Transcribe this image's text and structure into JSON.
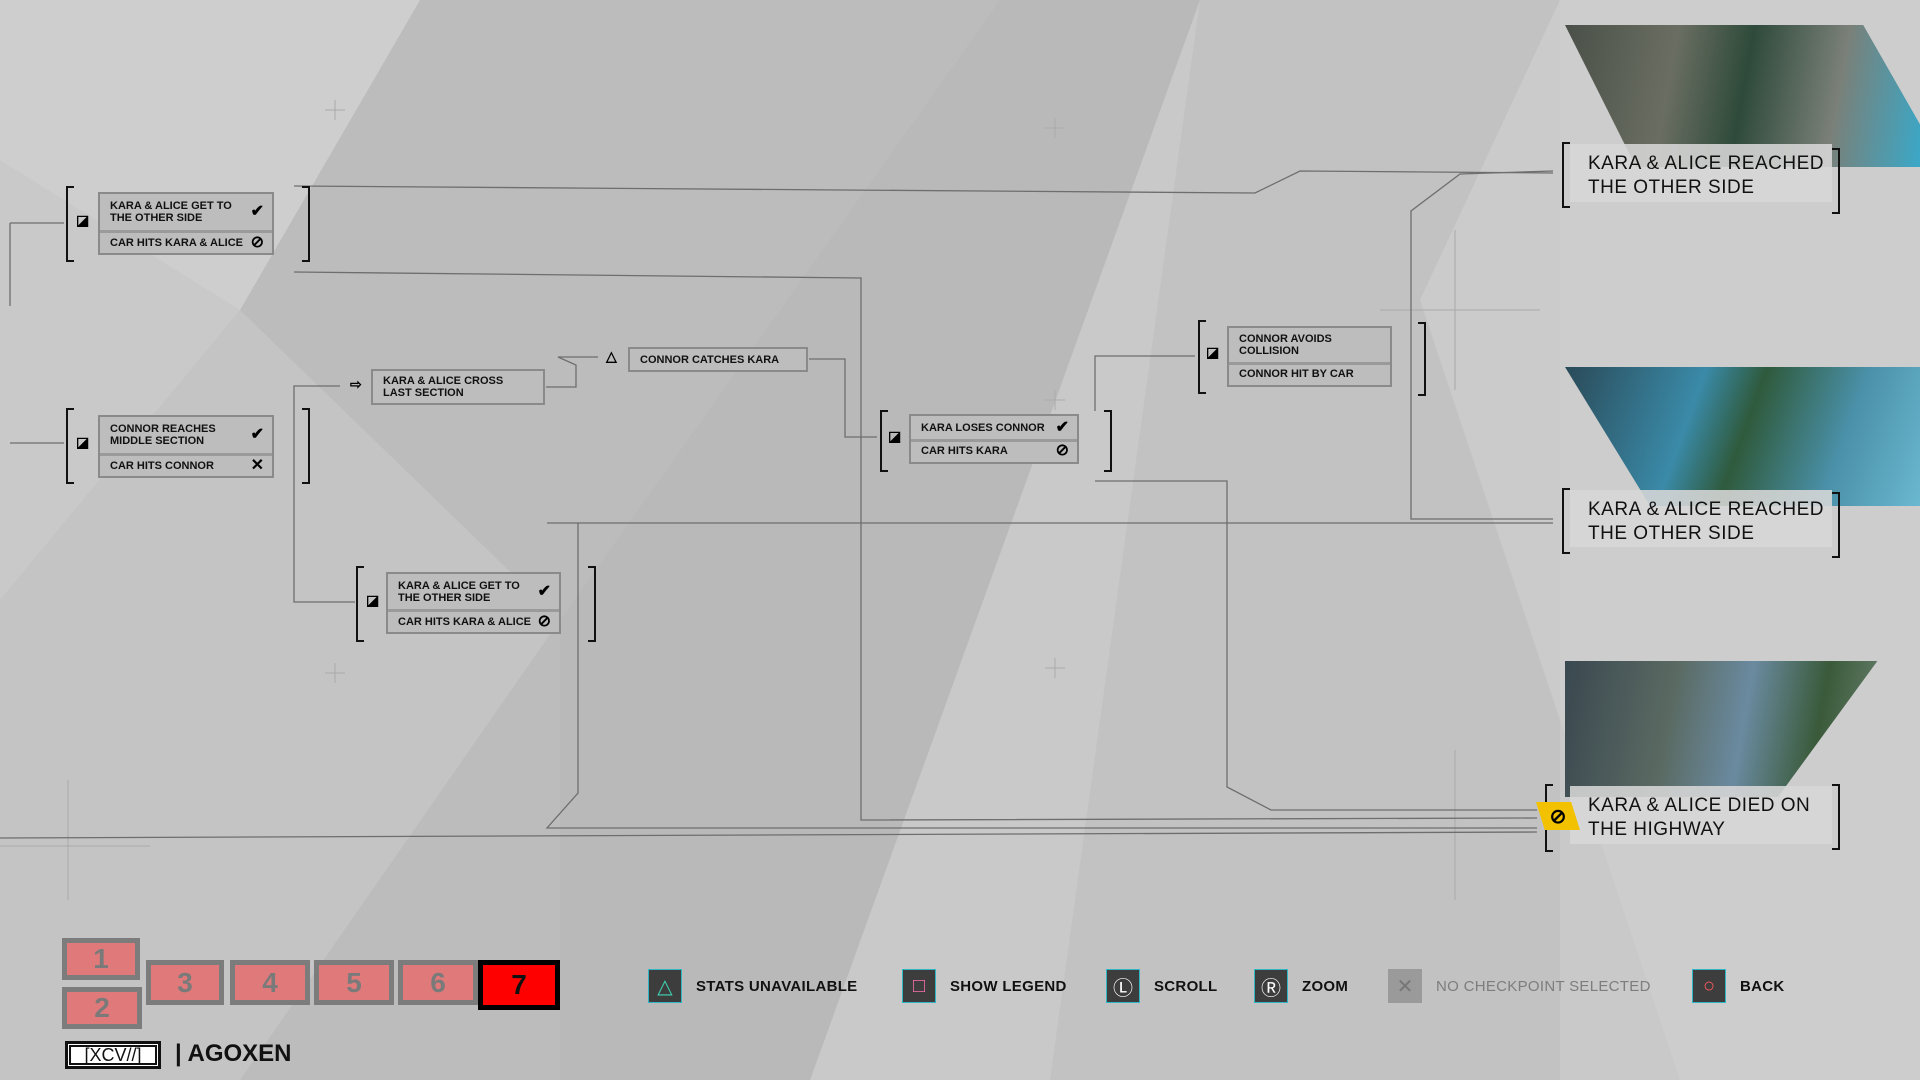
{
  "nodes": {
    "choice_top": {
      "options": [
        {
          "label": "KARA & ALICE GET TO THE OTHER SIDE",
          "status": "check"
        },
        {
          "label": "CAR HITS KARA & ALICE",
          "status": "blocked"
        }
      ]
    },
    "choice_mid": {
      "options": [
        {
          "label": "CONNOR REACHES MIDDLE SECTION",
          "status": "check"
        },
        {
          "label": "CAR HITS CONNOR",
          "status": "failed"
        }
      ]
    },
    "cross_section": {
      "label": "KARA & ALICE CROSS LAST SECTION"
    },
    "connor_catches": {
      "label": "CONNOR CATCHES KARA"
    },
    "choice_low": {
      "options": [
        {
          "label": "KARA & ALICE GET TO THE OTHER SIDE",
          "status": "check"
        },
        {
          "label": "CAR HITS KARA & ALICE",
          "status": "blocked"
        }
      ]
    },
    "loses_connor": {
      "options": [
        {
          "label": "KARA LOSES CONNOR",
          "status": "check"
        },
        {
          "label": "CAR HITS KARA",
          "status": "blocked"
        }
      ]
    },
    "connor_avoids": {
      "options": [
        {
          "label": "CONNOR AVOIDS COLLISION",
          "status": ""
        },
        {
          "label": "CONNOR HIT BY CAR",
          "status": ""
        }
      ]
    }
  },
  "status_glyphs": {
    "check": "✔",
    "blocked": "⃠",
    "failed": "✕"
  },
  "endings": [
    {
      "title": "KARA & ALICE REACHED THE OTHER SIDE",
      "badge": ""
    },
    {
      "title": "KARA & ALICE REACHED THE OTHER SIDE",
      "badge": ""
    },
    {
      "title": "KARA & ALICE DIED ON THE HIGHWAY",
      "badge": "prohibited-icon"
    }
  ],
  "chapters": {
    "items": [
      "1",
      "2",
      "3",
      "4",
      "5",
      "6",
      "7"
    ],
    "active": "7"
  },
  "brand": {
    "tag": "[XCV//]",
    "name": "| AGOXEN"
  },
  "watermark": "AGOXEN",
  "controls": [
    {
      "icon": "triangle-icon",
      "glyph": "△",
      "color": "#3fd6b4",
      "label": "STATS UNAVAILABLE"
    },
    {
      "icon": "square-icon",
      "glyph": "□",
      "color": "#ff6fb0",
      "label": "SHOW LEGEND"
    },
    {
      "icon": "left-stick-icon",
      "glyph": "Ⓛ",
      "color": "#ffffff",
      "label": "SCROLL"
    },
    {
      "icon": "right-stick-icon",
      "glyph": "Ⓡ",
      "color": "#ffffff",
      "label": "ZOOM"
    },
    {
      "icon": "cross-icon",
      "glyph": "✕",
      "color": "#8a8a8a",
      "label": "NO CHECKPOINT SELECTED"
    },
    {
      "icon": "circle-icon",
      "glyph": "○",
      "color": "#ff5a5a",
      "label": "BACK"
    }
  ],
  "colors": {
    "background": "#c9c9c9",
    "chapter": "#e07a7a",
    "active_chapter": "#ff0000",
    "badge": "#f2c200"
  }
}
